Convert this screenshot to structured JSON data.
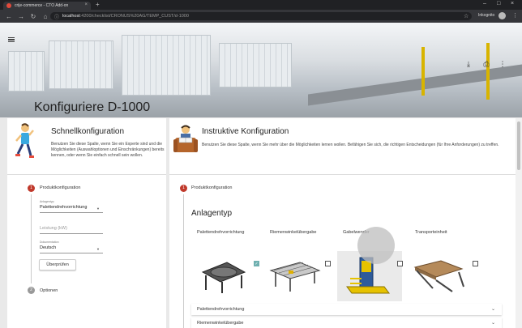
{
  "browser": {
    "tab_title": "crije-commerce - CTO Add-on",
    "tab_close": "×",
    "new_tab": "+",
    "url_host": "localhost",
    "url_path": ":4200/checklist/CRONUS%20AG/TEMP_CUST/d-1000",
    "profile_label": "Inkognito",
    "window_controls": [
      "–",
      "□",
      "×"
    ]
  },
  "hero": {
    "title": "Konfiguriere D-1000"
  },
  "quick_config": {
    "title": "Schnellkonfiguration",
    "description": "Benutzen Sie diese Spalte, wenn Sie ein Experte sind und die Möglichkeiten (Auswahloptionen und Einschränkungen) bereits kennen, oder wenn Sie einfach schnell sein wollen.",
    "steps": [
      {
        "number": "1",
        "label": "Produktkonfiguration"
      },
      {
        "number": "2",
        "label": "Optionen"
      }
    ],
    "fields": {
      "anlagentyp_label": "Anlagentyp",
      "anlagentyp_value": "Palettendrehvorrichtung",
      "leistung_placeholder": "Leistung (kW)",
      "dokumentation_label": "Dokumentation",
      "dokumentation_value": "Deutsch"
    },
    "check_button": "Überprüfen"
  },
  "guided_config": {
    "title": "Instruktive Konfiguration",
    "description": "Benutzen Sie diese Spalte, wenn Sie mehr über die Möglichkeiten lernen wollen. Befähigen Sie sich, die richtigen Entscheidungen (für Ihre Anforderungen) zu treffen.",
    "step": {
      "number": "1",
      "label": "Produktkonfiguration"
    },
    "section_title": "Anlagentyp",
    "types": [
      {
        "label": "Palettendrehvorrichtung",
        "checked": true
      },
      {
        "label": "Riemenwinkelübergabe",
        "checked": false
      },
      {
        "label": "Gabelwender",
        "checked": false
      },
      {
        "label": "Transporteinheit",
        "checked": false
      }
    ],
    "accordion": [
      {
        "label": "Palettendrehvorrichtung"
      },
      {
        "label": "Riemenwinkelübergabe"
      }
    ]
  },
  "icons": {
    "check": "✓",
    "caret_down": "▼",
    "chevron_down": "⌄"
  },
  "colors": {
    "accent_red": "#c0392b",
    "checkbox_teal": "#6fb0b0",
    "chrome_dark": "#202124"
  }
}
